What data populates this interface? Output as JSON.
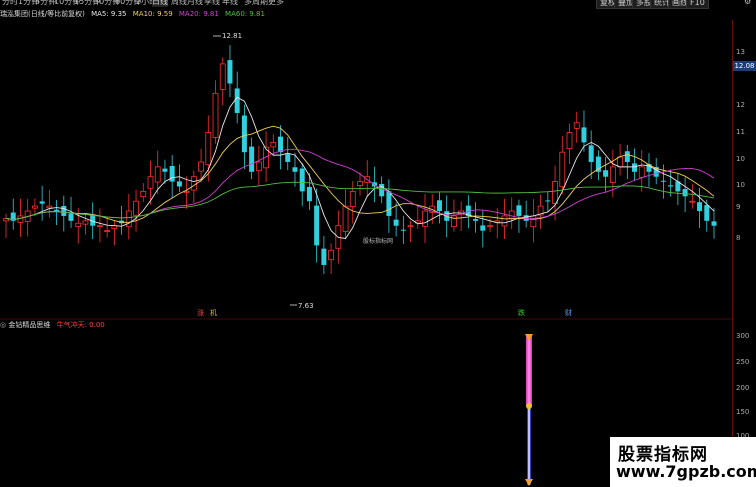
{
  "period_tabs": [
    "分时",
    "1分钟",
    "5分钟",
    "10分钟",
    "15分钟",
    "30分钟",
    "60分钟",
    "2小时",
    "日线",
    "周线",
    "月线",
    "季线",
    "年线",
    "多周期",
    "更多"
  ],
  "right_buttons": [
    "复权",
    "叠加",
    "多股",
    "统计",
    "画线",
    "F10"
  ],
  "right_icon": "settings-icon",
  "info": {
    "stock": "瑞泓集团(日线/等比前复权)",
    "ma5": "MA5: 9.35",
    "ma10": "MA10: 9.59",
    "ma20": "MA20: 9.81",
    "ma60": "MA60: 9.81"
  },
  "chart": {
    "high_label": "12.81",
    "low_label": "7.63",
    "current_price": "12.08",
    "watermark": "股标指标网",
    "markers": [
      {
        "text": "涨",
        "color": "#ff4040"
      },
      {
        "text": "机",
        "color": "#e0b030"
      },
      {
        "text": "跌",
        "color": "#30d030"
      },
      {
        "text": "财",
        "color": "#4aa0ff"
      }
    ]
  },
  "y_axis_ticks": [
    "13",
    "12",
    "11",
    "10",
    "10",
    "9",
    "8",
    "300",
    "250",
    "200",
    "150",
    "100",
    "50"
  ],
  "sub_indicator": {
    "name": "金钻精品思维",
    "field": "牛气冲天: 0.00"
  },
  "logo": {
    "line1": "股票指标网",
    "line2": "www.7gpzb.com"
  },
  "colors": {
    "up": "#ff3030",
    "down": "#30d0e0",
    "ma5": "#e8e8e8",
    "ma10": "#f0d050",
    "ma20": "#d040d0",
    "ma60": "#50c040",
    "accent": "#1a3d7c"
  }
}
